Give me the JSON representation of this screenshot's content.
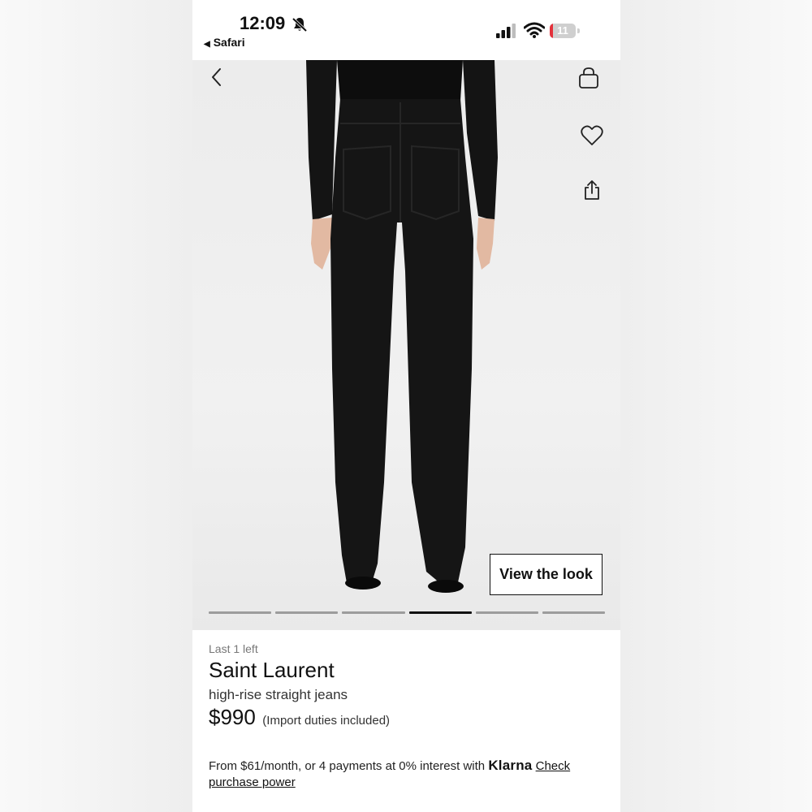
{
  "status_bar": {
    "time": "12:09",
    "back_app": "Safari",
    "battery": "11",
    "battery_level": 0.11,
    "battery_color": "#e4313b"
  },
  "hero": {
    "icons": [
      "chevron-left-icon",
      "shopping-bag-icon",
      "heart-icon",
      "share-icon"
    ],
    "view_look_label": "View the look",
    "carousel": {
      "total": 6,
      "active_index": 4
    }
  },
  "product": {
    "stock": "Last 1 left",
    "brand": "Saint Laurent",
    "description": "high-rise straight jeans",
    "price": "$990",
    "duties": "(Import duties included)"
  },
  "financing": {
    "text": "From $61/month, or 4 payments at 0% interest with",
    "provider": "Klarna",
    "link": "Check purchase power"
  }
}
